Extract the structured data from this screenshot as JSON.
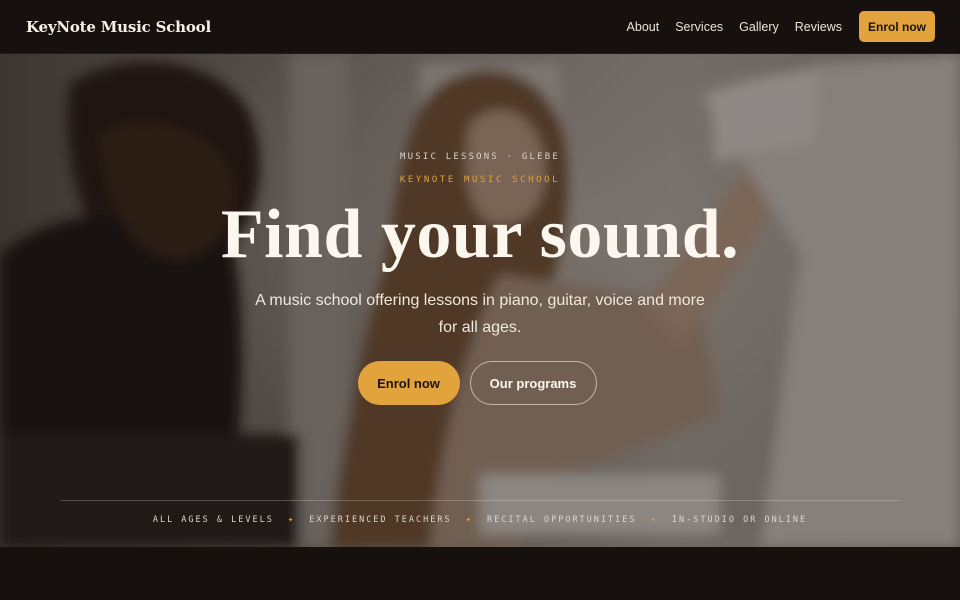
{
  "header": {
    "brand": "KeyNote Music School",
    "nav": [
      "About",
      "Services",
      "Gallery",
      "Reviews"
    ],
    "cta": "Enrol now"
  },
  "hero": {
    "eyebrow": "MUSIC LESSONS · GLEBE",
    "sub_eyebrow": "KEYNOTE MUSIC SCHOOL",
    "title": "Find your sound.",
    "description": "A music school offering lessons in piano, guitar, voice and more for all ages.",
    "primary_button": "Enrol now",
    "secondary_button": "Our programs",
    "features": [
      "ALL AGES & LEVELS",
      "EXPERIENCED TEACHERS",
      "RECITAL OPPORTUNITIES",
      "IN-STUDIO OR ONLINE"
    ],
    "feature_separator": "✦"
  },
  "colors": {
    "accent": "#e2a23c",
    "background": "#16110e",
    "text": "#f4efe7"
  }
}
